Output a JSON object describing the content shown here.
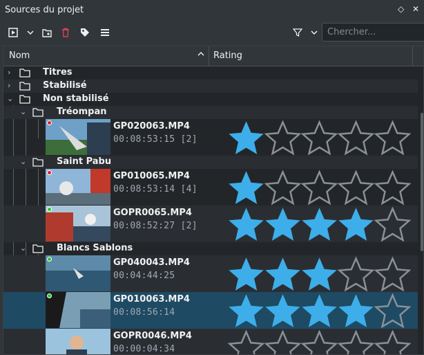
{
  "window": {
    "title": "Sources du projet",
    "float_glyph": "◇",
    "close_glyph": "✕"
  },
  "toolbar": {
    "icons": [
      "add-clip-icon",
      "dropdown-icon",
      "new-folder-icon",
      "delete-icon",
      "tag-icon",
      "menu-icon",
      "filter-icon",
      "filter-dropdown-icon"
    ],
    "search_placeholder": "Chercher..."
  },
  "columns": {
    "name": "Nom",
    "rating": "Rating"
  },
  "tree": {
    "folders": {
      "titres": "Titres",
      "stabilise": "Stabilisé",
      "non_stabilise": "Non stabilisé",
      "treompan": "Tréompan",
      "saint_pabu": "Saint Pabu",
      "blancs_sablons": "Blancs Sablons"
    },
    "clips": [
      {
        "name": "GP020063.MP4",
        "duration": "00:08:53:15 [2]",
        "rating": 1,
        "dot": "#e0201c"
      },
      {
        "name": "GP010065.MP4",
        "duration": "00:08:53:14 [4]",
        "rating": 1,
        "dot": "#e0201c"
      },
      {
        "name": "GOPR0065.MP4",
        "duration": "00:08:52:27 [2]",
        "rating": 4,
        "dot": "#26c826"
      },
      {
        "name": "GP040043.MP4",
        "duration": "00:04:44:25",
        "rating": 3,
        "dot": "#26c826"
      },
      {
        "name": "GP010063.MP4",
        "duration": "00:08:56:14",
        "rating": 4,
        "dot": "#26c826"
      },
      {
        "name": "GOPR0046.MP4",
        "duration": "00:00:04:34",
        "rating": 0,
        "dot": ""
      }
    ]
  },
  "colors": {
    "star_fill": "#3daee9",
    "star_empty_stroke": "#8a9096",
    "selection": "#1e4a63"
  }
}
